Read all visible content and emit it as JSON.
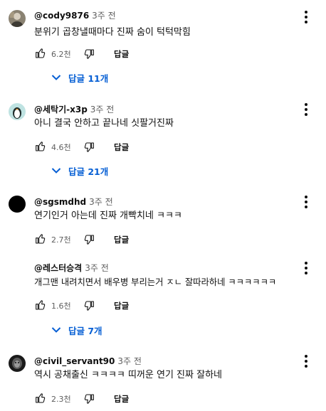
{
  "comments": [
    {
      "author": "@cody9876",
      "time": "3주 전",
      "text": "분위기 곱창낼때마다 진짜 숨이 턱턱막힘",
      "likes": "6.2천",
      "reply_label": "답글",
      "replies_toggle": "답글 11개"
    },
    {
      "author": "@세탁기-x3p",
      "time": "3주 전",
      "text": "아니 결국 안하고 끝나네 싯팔거진짜",
      "likes": "4.6천",
      "reply_label": "답글",
      "replies_toggle": "답글 21개"
    },
    {
      "author": "@sgsmdhd",
      "time": "3주 전",
      "text": "연기인거 아는데 진짜 개빡치네 ㅋㅋㅋ",
      "likes": "2.7천",
      "reply_label": "답글"
    },
    {
      "author": "@레스터승격",
      "time": "3주 전",
      "text": "개그맨 내려치면서 배우병 부리는거 ㅈㄴ 잘따라하네 ㅋㅋㅋㅋㅋㅋ",
      "likes": "1.6천",
      "reply_label": "답글",
      "replies_toggle": "답글 7개"
    },
    {
      "author": "@civil_servant90",
      "time": "3주 전",
      "text": "역시 공채출신 ㅋㅋㅋㅋ 띠꺼운 연기 진짜 잘하네",
      "likes": "2.3천",
      "reply_label": "답글"
    }
  ],
  "colors": {
    "link": "#065fd4",
    "meta": "#606060",
    "text": "#0f0f0f"
  },
  "icons": [
    "like-icon",
    "dislike-icon",
    "more-vert-icon",
    "chevron-down-icon"
  ]
}
